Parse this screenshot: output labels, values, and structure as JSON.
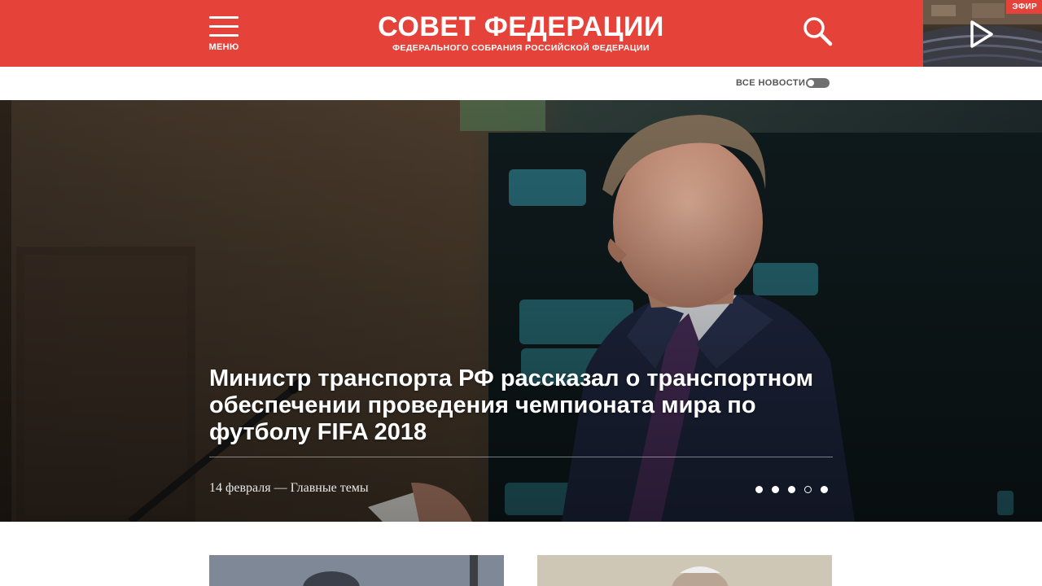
{
  "header": {
    "menu_label": "МЕНЮ",
    "title": "СОВЕТ ФЕДЕРАЦИИ",
    "subtitle": "ФЕДЕРАЛЬНОГО СОБРАНИЯ РОССИЙСКОЙ ФЕДЕРАЦИИ",
    "search_icon": "search-icon",
    "live_label": "ЭФИР",
    "live_icon": "play-icon",
    "accent_color": "#e5433a"
  },
  "subbar": {
    "all_news_label": "ВСЕ НОВОСТИ",
    "all_news_toggle_on": false
  },
  "hero": {
    "headline": "Министр транспорта РФ рассказал о транспортном обеспечении проведения чемпионата мира по футболу FIFA 2018",
    "meta": "14 февраля — Главные темы",
    "slide_count": 5,
    "active_slide": 4
  },
  "cards": [
    {
      "image": "photo-card-1"
    },
    {
      "image": "photo-card-2"
    }
  ]
}
